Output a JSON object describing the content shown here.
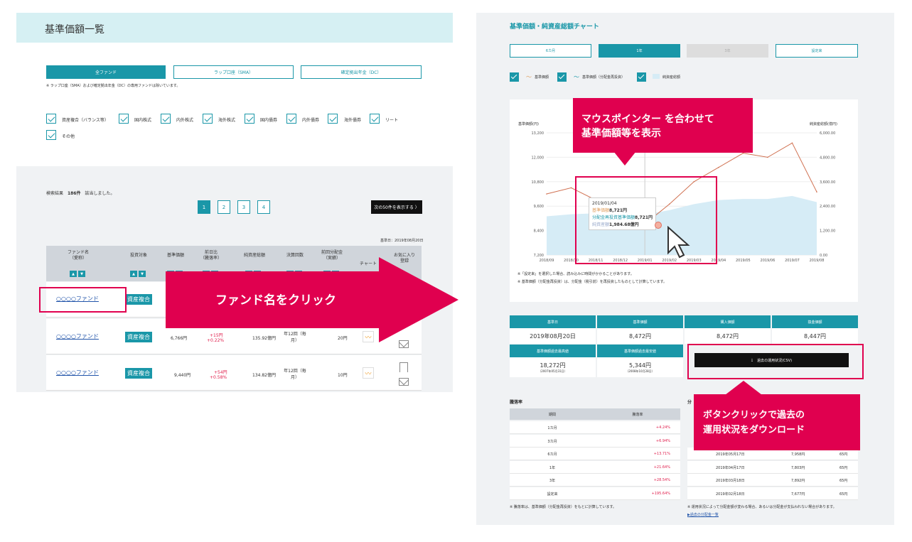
{
  "left": {
    "title": "基準価額一覧",
    "tabs": [
      {
        "label": "全ファンド",
        "active": true
      },
      {
        "label": "ラップ口座（SMA）",
        "active": false
      },
      {
        "label": "確定拠出年金（DC）",
        "active": false
      }
    ],
    "tabs_note": "※ ラップ口座（SMA）および確定拠出年金（DC）の専用ファンドは除いています。",
    "filters": [
      "資産複合（バランス等）",
      "国内株式",
      "内外株式",
      "海外株式",
      "国内債券",
      "内外債券",
      "海外債券",
      "リート",
      "その他"
    ],
    "results": {
      "prefix": "検索結果",
      "count": "186件",
      "suffix": "該当しました。"
    },
    "pages": [
      "1",
      "2",
      "3",
      "4"
    ],
    "next_label": "次の50件を表示する 〉",
    "base_date": "基準日：2019年08月20日",
    "headers": {
      "fund": "ファンド名\n（愛称）",
      "target": "投資対象",
      "nav": "基準価額",
      "change": "前日比\n（騰落率）",
      "assets": "純資産総額",
      "settle": "決算回数",
      "dist": "前回分配金\n（実績）",
      "chart": "チャート",
      "fav": "お気に入り\n登録"
    },
    "sort_asc": "▲",
    "sort_desc": "▼",
    "rows": [
      {
        "fund": "○○○○ファンド",
        "target": "資産複合"
      },
      {
        "fund": "○○○○ファンド",
        "target": "資産複合",
        "nav": "6,766円",
        "change": "+15円",
        "rate": "+0.22%",
        "assets": "135.92億円",
        "settle": "年12回（毎月）",
        "dist": "20円",
        "chart_icon": "chart-icon"
      },
      {
        "fund": "○○○○ファンド",
        "target": "資産複合",
        "nav": "9,440円",
        "change": "+54円",
        "rate": "+0.58%",
        "assets": "134.82億円",
        "settle": "年12回（毎月）",
        "dist": "10円",
        "chart_icon": "chart-icon"
      }
    ],
    "arrow_text": "ファンド名をクリック"
  },
  "right": {
    "title": "基準価額・純資産総額チャート",
    "period_tabs": [
      {
        "label": "6カ月",
        "state": "normal"
      },
      {
        "label": "1年",
        "state": "active"
      },
      {
        "label": "3年",
        "state": "disabled"
      },
      {
        "label": "設定来",
        "state": "normal"
      }
    ],
    "legend": [
      "基準価額",
      "基準価額（分配金再投資）",
      "純資産総額"
    ],
    "callout1": "マウスポインター を合わせて\n基準価額等を表示",
    "tooltip": {
      "date": "2019/01/04",
      "nav_label": "基準価額",
      "nav": "8,721円",
      "reinvest_label": "分配金再投資基準価額",
      "reinvest": "8,721円",
      "assets_label": "純資産額",
      "assets": "1,984.68億円"
    },
    "notes": [
      "※「設定来」を選択した場合、読み込みに時間がかかることがあります。",
      "※ 基準価額（分配金再投資）は、分配金（税引前）を再投資したものとして計算しています。"
    ],
    "info_headers": [
      "基準日",
      "基準価額",
      "購入価額",
      "換金価額"
    ],
    "info_values": [
      "2019年08月20日",
      "8,472円",
      "8,472円",
      "8,447円"
    ],
    "hi_lo_headers": [
      "基準価額過去最高値",
      "基準価額過去最安値"
    ],
    "hi": {
      "value": "18,272円",
      "date": "（2007年05月31日）"
    },
    "lo": {
      "value": "5,344円",
      "date": "（2008年10月28日）"
    },
    "csv_label": "過去の運用状況(CSV)",
    "callout2": "ボタンクリックで過去の\n運用状況をダウンロード",
    "perf_title": "騰落率",
    "perf_headers": [
      "期間",
      "騰落率"
    ],
    "perf_rows": [
      {
        "period": "1カ月",
        "rate": "+4.24%"
      },
      {
        "period": "3カ月",
        "rate": "+6.94%"
      },
      {
        "period": "6カ月",
        "rate": "+13.71%"
      },
      {
        "period": "1年",
        "rate": "+21.64%"
      },
      {
        "period": "3年",
        "rate": "+28.54%"
      },
      {
        "period": "設定来",
        "rate": "+195.64%"
      }
    ],
    "perf_note": "※ 騰落率は、基準価額（分配金再投資）をもとに計算しています。",
    "dist_title": "分",
    "dist_rows": [
      {
        "date": "2019年05月17日",
        "nav": "7,958円",
        "dist": "65円"
      },
      {
        "date": "2019年04月17日",
        "nav": "7,803円",
        "dist": "65円"
      },
      {
        "date": "2019年03月18日",
        "nav": "7,892円",
        "dist": "65円"
      },
      {
        "date": "2019年02月18日",
        "nav": "7,677円",
        "dist": "65円"
      }
    ],
    "dist_note": "※ 運用状況によって分配金額が変わる場合、あるいは分配金が支払われない場合があります。",
    "dist_link": "▶過去の分配金一覧"
  },
  "chart_data": {
    "type": "line",
    "title": "",
    "ylabel_left": "基準価額(円)",
    "ylabel_right": "純資産総額(億円)",
    "x_ticks": [
      "2018/09",
      "2018/10",
      "2018/11",
      "2018/12",
      "2019/01",
      "2019/02",
      "2019/03",
      "2019/04",
      "2019/05",
      "2019/06",
      "2019/07",
      "2019/08"
    ],
    "x_tick_labels": [
      "2018/09",
      "2018/10",
      "2018/11",
      "2018/12",
      "2019/01",
      "2019/02",
      "2019/03",
      "2019/04",
      "2019/05",
      "2019/06",
      "2019/07",
      "2019/08"
    ],
    "ylim_left": [
      7200,
      13200
    ],
    "y_ticks_left": [
      "13,200",
      "12,000",
      "10,800",
      "9,600",
      "8,400",
      "7,200"
    ],
    "ylim_right": [
      0,
      6000
    ],
    "y_ticks_right": [
      "6,000.00",
      "4,800.00",
      "3,600.00",
      "2,400.00",
      "1,200.00",
      "0.00"
    ],
    "series": [
      {
        "name": "基準価額",
        "color": "#e0a060",
        "axis": "left",
        "x": [
          "2018/09",
          "2018/10",
          "2018/11",
          "2018/12",
          "2019/01",
          "2019/02",
          "2019/03",
          "2019/04",
          "2019/05",
          "2019/06",
          "2019/07",
          "2019/08"
        ],
        "values": [
          10200,
          10500,
          9900,
          9300,
          8721,
          9700,
          10800,
          11500,
          12200,
          12000,
          12700,
          10300
        ]
      },
      {
        "name": "純資産総額",
        "color": "#d6ecf6",
        "axis": "right",
        "x": [
          "2018/09",
          "2018/10",
          "2018/11",
          "2018/12",
          "2019/01",
          "2019/02",
          "2019/03",
          "2019/04",
          "2019/05",
          "2019/06",
          "2019/07",
          "2019/08"
        ],
        "values": [
          1900,
          2000,
          2050,
          2050,
          1984.68,
          2200,
          2500,
          2700,
          2750,
          2750,
          2900,
          2600
        ]
      }
    ]
  }
}
